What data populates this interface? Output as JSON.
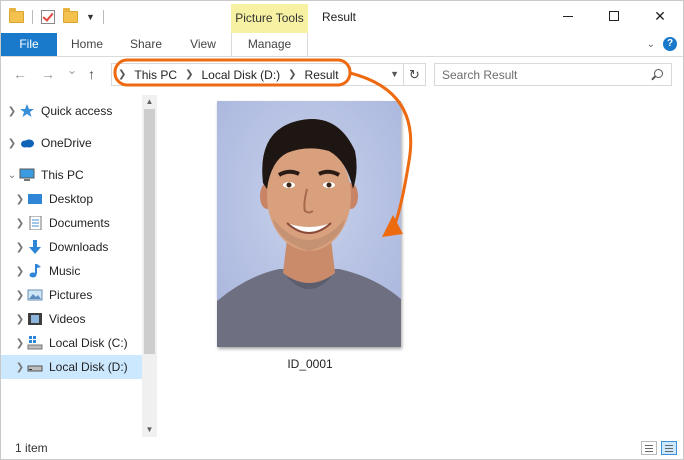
{
  "window": {
    "title": "Result",
    "context_tab": "Picture Tools",
    "minimize_glyph": "—",
    "close_glyph": "✕"
  },
  "ribbon": {
    "tabs": [
      "File",
      "Home",
      "Share",
      "View",
      "Manage"
    ],
    "help_glyph": "?"
  },
  "address": {
    "back_glyph": "←",
    "forward_glyph": "→",
    "recent_glyph": "⌄",
    "up_glyph": "↑",
    "crumbs": [
      "This PC",
      "Local Disk (D:)",
      "Result"
    ],
    "refresh_glyph": "↻",
    "search_placeholder": "Search Result"
  },
  "nav": {
    "items": [
      {
        "label": "Quick access",
        "icon": "star-icon"
      },
      {
        "label": "OneDrive",
        "icon": "cloud-icon"
      },
      {
        "label": "This PC",
        "icon": "monitor-icon"
      },
      {
        "label": "Desktop",
        "icon": "desktop-icon"
      },
      {
        "label": "Documents",
        "icon": "documents-icon"
      },
      {
        "label": "Downloads",
        "icon": "download-icon"
      },
      {
        "label": "Music",
        "icon": "music-icon"
      },
      {
        "label": "Pictures",
        "icon": "pictures-icon"
      },
      {
        "label": "Videos",
        "icon": "videos-icon"
      },
      {
        "label": "Local Disk (C:)",
        "icon": "drive-c-icon"
      },
      {
        "label": "Local Disk (D:)",
        "icon": "drive-icon"
      }
    ]
  },
  "content": {
    "files": [
      {
        "name": "ID_0001"
      }
    ]
  },
  "status": {
    "item_count": "1 item"
  },
  "colors": {
    "accent": "#1979ca",
    "context_tab_bg": "#f6f1a3",
    "selection": "#cce8ff",
    "annotation_orange": "#ee6a10"
  }
}
